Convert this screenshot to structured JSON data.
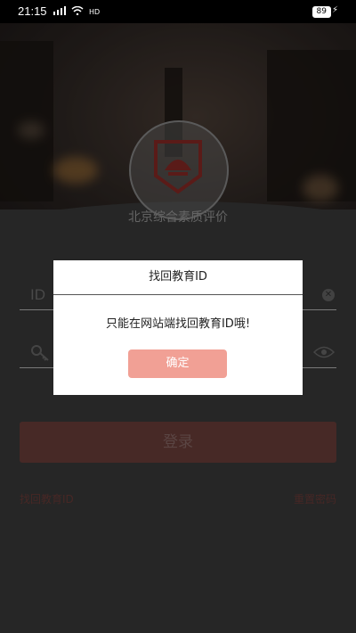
{
  "status": {
    "time": "21:15",
    "battery": "89"
  },
  "app": {
    "name": "北京综合素质评价"
  },
  "form": {
    "id_placeholder": "ID",
    "login_label": "登录",
    "find_id_link": "找回教育ID",
    "reset_password_link": "重置密码"
  },
  "dialog": {
    "title": "找回教育ID",
    "message": "只能在网站端找回教育ID哦!",
    "ok_label": "确定"
  },
  "colors": {
    "accent": "#f1a095",
    "brand_red": "#b8302a"
  }
}
